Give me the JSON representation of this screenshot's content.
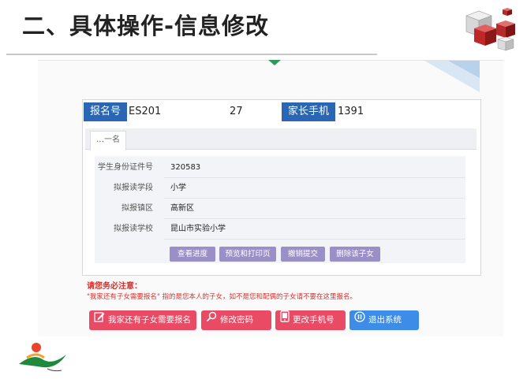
{
  "slide": {
    "title": "二、具体操作-信息修改"
  },
  "header": {
    "reg_no_label": "报名号",
    "reg_no_value": "ES201                     27",
    "parent_phone_label": "家长手机",
    "parent_phone_value": "1391                "
  },
  "tabs": [
    {
      "label": "…一名"
    }
  ],
  "form": {
    "rows": [
      {
        "label": "学生身份证件号",
        "value": "320583"
      },
      {
        "label": "拟报读学段",
        "value": "小学"
      },
      {
        "label": "拟报镇区",
        "value": "高新区"
      },
      {
        "label": "拟报读学校",
        "value": "昆山市实验小学"
      }
    ],
    "actions": [
      "查看进度",
      "预览和打印页",
      "撤销提交",
      "删除该子女"
    ]
  },
  "notice": {
    "title": "请您务必注意：",
    "text": "\"我家还有子女需要报名\" 指的是您本人的子女，如不是您和配偶的子女请不要在这里报名。"
  },
  "bottom_buttons": [
    {
      "label": "我家还有子女需要报名",
      "icon": "edit-icon",
      "color": "#e94a64"
    },
    {
      "label": "修改密码",
      "icon": "search-key-icon",
      "color": "#e94a64"
    },
    {
      "label": "更改手机号",
      "icon": "phone-icon",
      "color": "#e94a64"
    },
    {
      "label": "退出系统",
      "icon": "pause-exit-icon",
      "color": "#3d8de8"
    }
  ]
}
